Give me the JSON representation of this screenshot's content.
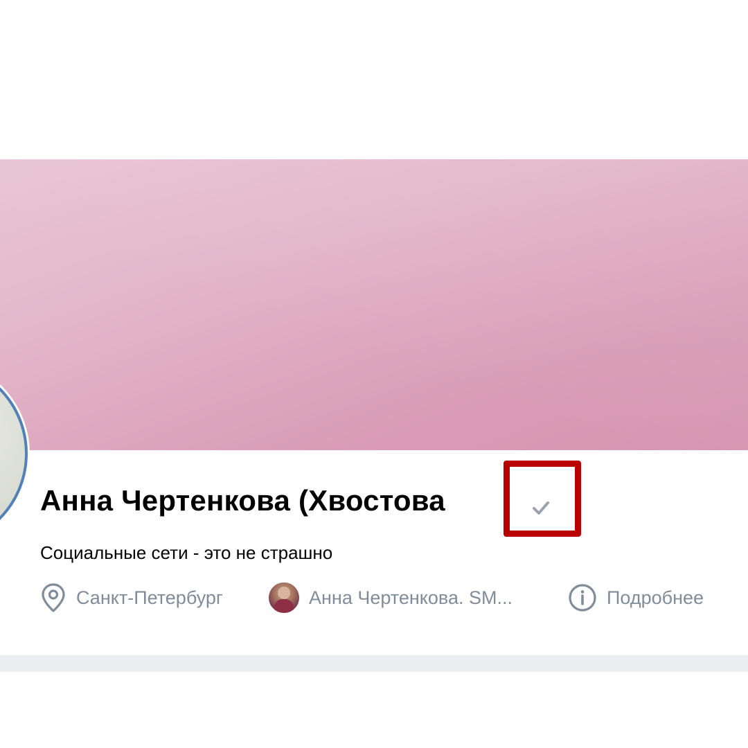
{
  "profile": {
    "name": "Анна Чертенкова (Хвостова",
    "status": "Социальные сети - это не страшно",
    "verified_icon": "check-icon"
  },
  "meta": {
    "city": "Санкт-Петербург",
    "city_icon": "location-pin-icon",
    "group": "Анна Чертенкова. SM...",
    "group_icon": "group-avatar",
    "details": "Подробнее",
    "details_icon": "info-icon"
  },
  "colors": {
    "cover_start": "#e9c6d6",
    "cover_end": "#d595b0",
    "avatar_border": "#5181b8",
    "highlight_box": "#b80000",
    "meta_text": "#818c99"
  }
}
